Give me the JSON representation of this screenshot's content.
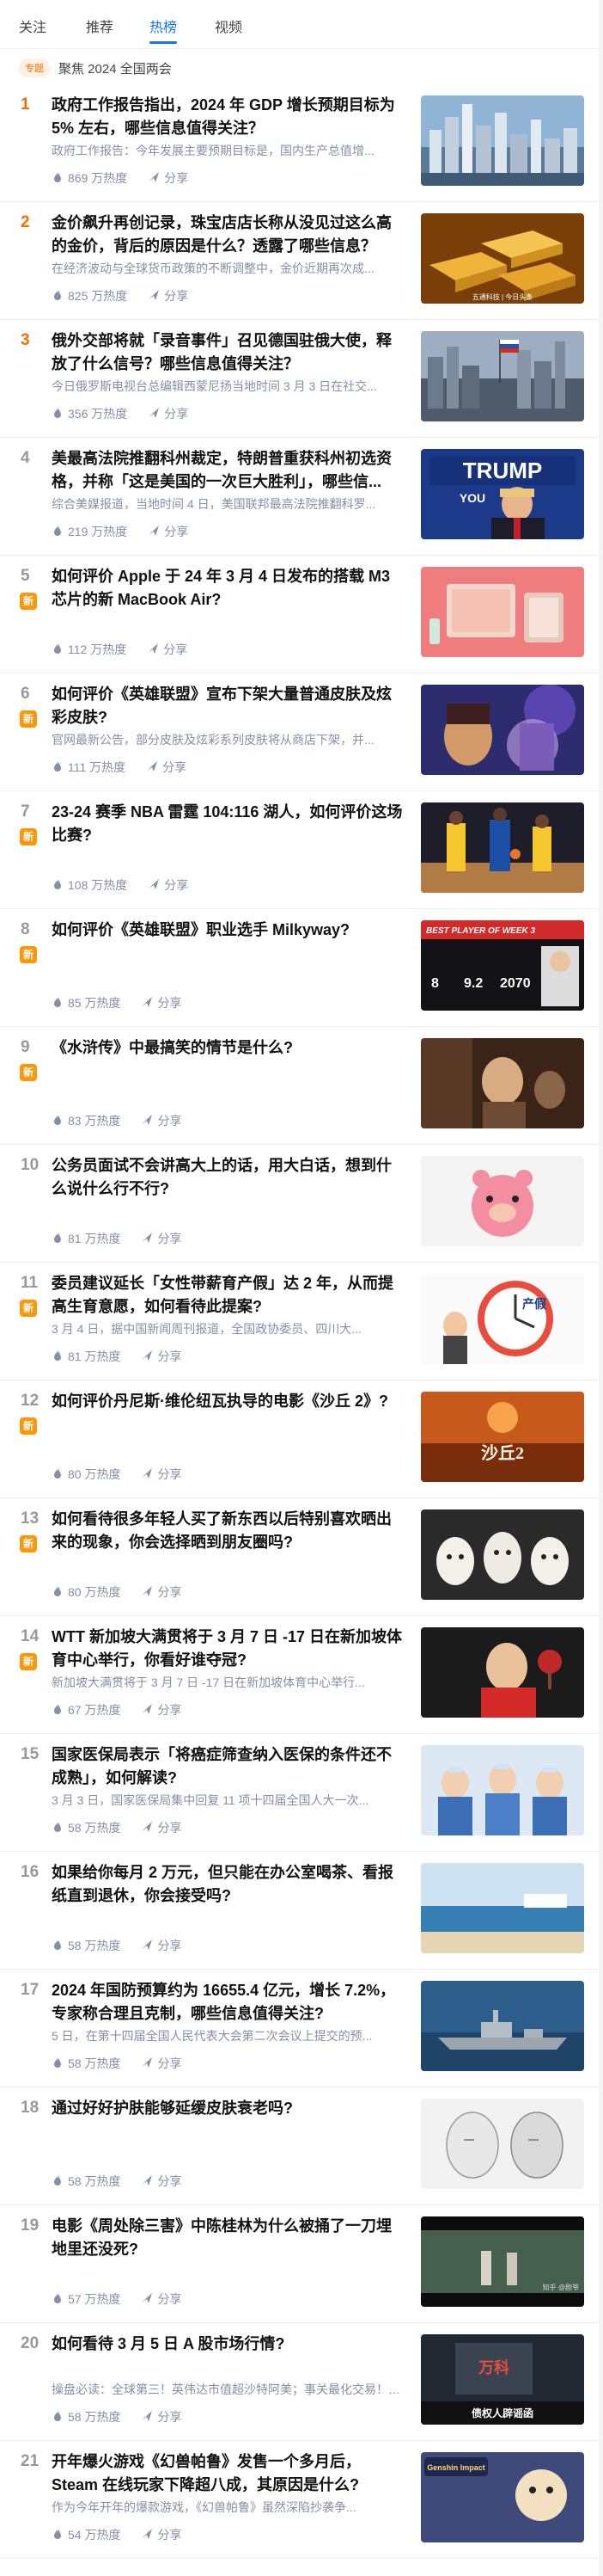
{
  "tabs": [
    {
      "label": "关注",
      "active": false
    },
    {
      "label": "推荐",
      "active": false
    },
    {
      "label": "热榜",
      "active": true
    },
    {
      "label": "视频",
      "active": false
    }
  ],
  "topic": {
    "badge": "专题",
    "text": "聚焦 2024 全国两会"
  },
  "share_label": "分享",
  "new_label": "新",
  "icons": {
    "heat": "fire-icon",
    "share": "share-icon"
  },
  "colors": {
    "accent": "#1772f6",
    "rank_top": "#ff6a00",
    "new_badge": "#ff9607"
  },
  "items": [
    {
      "rank": "1",
      "title": "政府工作报告指出，2024 年 GDP 增长预期目标为 5% 左右，哪些信息值得关注？",
      "excerpt": "政府工作报告：今年发展主要预期目标是，国内生产总值增...",
      "heat": "869 万热度",
      "is_new": false
    },
    {
      "rank": "2",
      "title": "金价飙升再创记录，珠宝店店长称从没见过这么高的金价，背后的原因是什么？透露了哪些信息？",
      "excerpt": "在经济波动与全球货币政策的不断调整中，金价近期再次成...",
      "heat": "825 万热度",
      "is_new": false
    },
    {
      "rank": "3",
      "title": "俄外交部将就「录音事件」召见德国驻俄大使，释放了什么信号？哪些信息值得关注？",
      "excerpt": "今日俄罗斯电视台总编辑西蒙尼扬当地时间 3 月 3 日在社交...",
      "heat": "356 万热度",
      "is_new": false
    },
    {
      "rank": "4",
      "title": "美最高法院推翻科州裁定，特朗普重获科州初选资格，并称「这是美国的一次巨大胜利」，哪些信...",
      "excerpt": "综合美媒报道，当地时间 4 日，美国联邦最高法院推翻科罗...",
      "heat": "219 万热度",
      "is_new": false
    },
    {
      "rank": "5",
      "title": "如何评价 Apple 于 24 年 3 月 4 日发布的搭载 M3 芯片的新 MacBook Air?",
      "excerpt": "",
      "heat": "112 万热度",
      "is_new": true
    },
    {
      "rank": "6",
      "title": "如何评价《英雄联盟》宣布下架大量普通皮肤及炫彩皮肤?",
      "excerpt": "官网最新公告，部分皮肤及炫彩系列皮肤将从商店下架，并...",
      "heat": "111 万热度",
      "is_new": true
    },
    {
      "rank": "7",
      "title": "23-24 赛季 NBA 雷霆 104:116 湖人，如何评价这场比赛?",
      "excerpt": "",
      "heat": "108 万热度",
      "is_new": true
    },
    {
      "rank": "8",
      "title": "如何评价《英雄联盟》职业选手 Milkyway?",
      "excerpt": "",
      "heat": "85 万热度",
      "is_new": true
    },
    {
      "rank": "9",
      "title": "《水浒传》中最搞笑的情节是什么?",
      "excerpt": "",
      "heat": "83 万热度",
      "is_new": true
    },
    {
      "rank": "10",
      "title": "公务员面试不会讲高大上的话，用大白话，想到什么说什么行不行?",
      "excerpt": "",
      "heat": "81 万热度",
      "is_new": false
    },
    {
      "rank": "11",
      "title": "委员建议延长「女性带薪育产假」达 2 年，从而提高生育意愿，如何看待此提案?",
      "excerpt": "3 月 4 日，据中国新闻周刊报道，全国政协委员、四川大...",
      "heat": "81 万热度",
      "is_new": true
    },
    {
      "rank": "12",
      "title": "如何评价丹尼斯·维伦纽瓦执导的电影《沙丘 2》?",
      "excerpt": "",
      "heat": "80 万热度",
      "is_new": true
    },
    {
      "rank": "13",
      "title": "如何看待很多年轻人买了新东西以后特别喜欢晒出来的现象，你会选择晒到朋友圈吗?",
      "excerpt": "",
      "heat": "80 万热度",
      "is_new": true
    },
    {
      "rank": "14",
      "title": "WTT 新加坡大满贯将于 3 月 7 日 -17 日在新加坡体育中心举行，你看好谁夺冠?",
      "excerpt": "新加坡大满贯将于 3 月 7 日 -17 日在新加坡体育中心举行...",
      "heat": "67 万热度",
      "is_new": true
    },
    {
      "rank": "15",
      "title": "国家医保局表示「将癌症筛查纳入医保的条件还不成熟」，如何解读?",
      "excerpt": "3 月 3 日，国家医保局集中回复 11 项十四届全国人大一次...",
      "heat": "58 万热度",
      "is_new": false
    },
    {
      "rank": "16",
      "title": "如果给你每月 2 万元，但只能在办公室喝茶、看报纸直到退休，你会接受吗?",
      "excerpt": "",
      "heat": "58 万热度",
      "is_new": false
    },
    {
      "rank": "17",
      "title": "2024 年国防预算约为 16655.4 亿元，增长 7.2%，专家称合理且克制，哪些信息值得关注?",
      "excerpt": "5 日，在第十四届全国人民代表大会第二次会议上提交的预...",
      "heat": "58 万热度",
      "is_new": false
    },
    {
      "rank": "18",
      "title": "通过好好护肤能够延缓皮肤衰老吗?",
      "excerpt": "",
      "heat": "58 万热度",
      "is_new": false
    },
    {
      "rank": "19",
      "title": "电影《周处除三害》中陈桂林为什么被捅了一刀埋地里还没死?",
      "excerpt": "",
      "heat": "57 万热度",
      "is_new": false
    },
    {
      "rank": "20",
      "title": "如何看待 3 月 5 日 A 股市场行情?",
      "excerpt": "操盘必读：全球第三！英伟达市值超沙特阿美；事关最化交易！沪深交易所发声 | 每经网",
      "heat": "58 万热度",
      "is_new": false
    },
    {
      "rank": "21",
      "title": "开年爆火游戏《幻兽帕鲁》发售一个多月后，Steam 在线玩家下降超八成，其原因是什么?",
      "excerpt": "作为今年开年的爆款游戏，《幻兽帕鲁》虽然深陷抄袭争...",
      "heat": "54 万热度",
      "is_new": false
    }
  ],
  "thumbs": [
    {
      "name": "city-skyline-thumb"
    },
    {
      "name": "gold-bars-thumb",
      "caption": "五通科技 | 今日头条"
    },
    {
      "name": "kremlin-city-thumb"
    },
    {
      "name": "trump-rally-thumb",
      "sign_top": "TRUMP",
      "sign_bottom": "YOU"
    },
    {
      "name": "macbook-air-thumb"
    },
    {
      "name": "lol-skins-thumb"
    },
    {
      "name": "nba-game-thumb"
    },
    {
      "name": "milkyway-stats-thumb",
      "header": "BEST PLAYER OF WEEK 3",
      "stats": [
        "8",
        "9.2",
        "2070"
      ]
    },
    {
      "name": "water-margin-thumb"
    },
    {
      "name": "pink-bear-thumb"
    },
    {
      "name": "maternity-leave-thumb",
      "label": "产假"
    },
    {
      "name": "dune-poster-thumb",
      "title": "沙丘2"
    },
    {
      "name": "eggs-faces-thumb"
    },
    {
      "name": "table-tennis-thumb"
    },
    {
      "name": "doctors-thumb"
    },
    {
      "name": "coastal-office-thumb"
    },
    {
      "name": "warship-thumb"
    },
    {
      "name": "face-sketch-thumb"
    },
    {
      "name": "movie-scene-thumb",
      "watermark": "知乎 @剧爷"
    },
    {
      "name": "stock-market-thumb",
      "label": "万科",
      "caption": "债权人辟谣函"
    },
    {
      "name": "palworld-thumb",
      "logo": "Genshin Impact"
    }
  ]
}
